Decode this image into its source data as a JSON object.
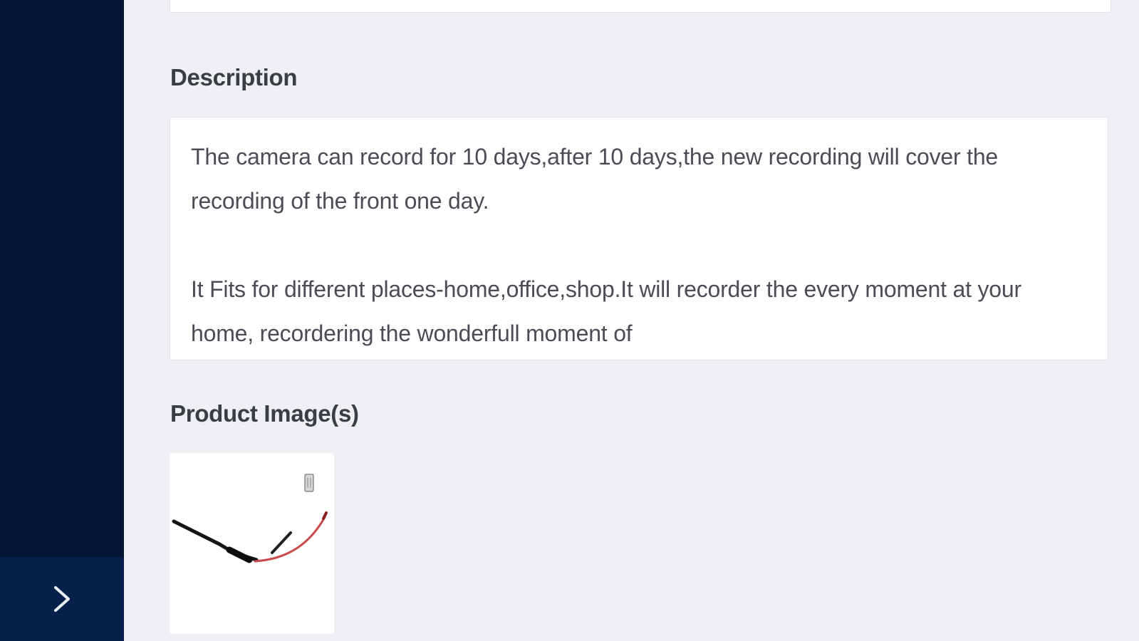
{
  "sidebar": {
    "toggle_icon": "chevron-right-icon",
    "background": "#021633",
    "toggle_background": "#05204a"
  },
  "form": {
    "description": {
      "label": "Description",
      "value": "The camera can record for 10 days,after 10 days,the new recording will cover the recording of the front one day.\n\nIt Fits for different places-home,office,shop.It will recorder the every moment at your home, recordering the wonderfull moment of"
    },
    "product_images": {
      "label": "Product Image(s)",
      "images": [
        {
          "subject": "camera-cable-image",
          "delete_icon": "trash-icon"
        }
      ]
    }
  }
}
